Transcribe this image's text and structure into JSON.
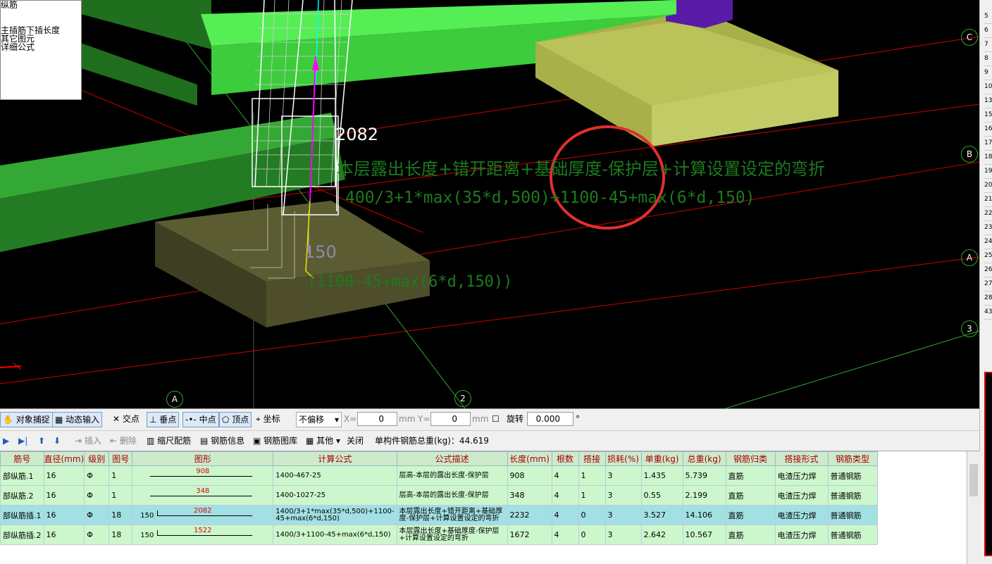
{
  "viewport": {
    "legend_lines": [
      "纵筋",
      "",
      "",
      "主插筋下插长度",
      "其它图元",
      "详细公式"
    ],
    "label_length_main": "2082",
    "label_length_sub": "150",
    "formula_desc": "本层露出长度+错开距离+基础厚度-保护层+计算设置设定的弯折",
    "formula_expr": "400/3+1*max(35*d,500)+1100-45+max(6*d,150)",
    "sub_expr": "(1100-45+max(6*d,150))",
    "axis_labels": {
      "c": "C",
      "b": "B",
      "a": "A",
      "n3": "3",
      "a_bottom": "A",
      "n2": "2"
    }
  },
  "right_strip": {
    "numbers": [
      "5",
      "6",
      "7",
      "8",
      "9",
      "10",
      "13",
      "15",
      "16",
      "17",
      "18",
      "19",
      "20",
      "21",
      "22",
      "23",
      "24",
      "25",
      "26",
      "27",
      "28",
      "43"
    ]
  },
  "toolbar1": {
    "snap": "对象捕捉",
    "dynamic_input": "动态输入",
    "intersection": "交点",
    "perpendicular": "垂点",
    "midpoint": "中点",
    "vertex": "顶点",
    "coordinate": "坐标",
    "offset_mode": "不偏移",
    "x_label": "X=",
    "x_value": "0",
    "x_unit": "mm",
    "y_label": "Y=",
    "y_value": "0",
    "y_unit": "mm",
    "rotate_label": "旋转",
    "rotate_value": "0.000",
    "degree": "°"
  },
  "toolbar2": {
    "insert": "插入",
    "delete": "删除",
    "scale_rebar": "缩尺配筋",
    "rebar_info": "钢筋信息",
    "rebar_library": "钢筋图库",
    "other": "其他",
    "close": "关闭",
    "total_weight": "单构件钢筋总重(kg)：44.619"
  },
  "table": {
    "headers": [
      "筋号",
      "直径(mm)",
      "级别",
      "图号",
      "图形",
      "计算公式",
      "公式描述",
      "长度(mm)",
      "根数",
      "搭接",
      "损耗(%)",
      "单重(kg)",
      "总重(kg)",
      "钢筋归类",
      "搭接形式",
      "钢筋类型"
    ],
    "rows": [
      {
        "style": "green",
        "name": "部纵筋.1",
        "dia": "16",
        "grade": "Φ",
        "fig": "1",
        "shape_pre": "",
        "shape_val": "908",
        "formula": "1400-467-25",
        "desc": "层高-本层的露出长度-保护层",
        "length": "908",
        "count": "4",
        "lap": "1",
        "loss": "3",
        "unit_w": "1.435",
        "total_w": "5.739",
        "cls": "直筋",
        "lap_type": "电渣压力焊",
        "type": "普通钢筋"
      },
      {
        "style": "green",
        "name": "部纵筋.2",
        "dia": "16",
        "grade": "Φ",
        "fig": "1",
        "shape_pre": "",
        "shape_val": "348",
        "formula": "1400-1027-25",
        "desc": "层高-本层的露出长度-保护层",
        "length": "348",
        "count": "4",
        "lap": "1",
        "loss": "3",
        "unit_w": "0.55",
        "total_w": "2.199",
        "cls": "直筋",
        "lap_type": "电渣压力焊",
        "type": "普通钢筋"
      },
      {
        "style": "cyan",
        "name": "部纵筋插.1",
        "dia": "16",
        "grade": "Φ",
        "fig": "18",
        "shape_pre": "150",
        "shape_val": "2082",
        "formula": "1400/3+1*max(35*d,500)+1100-45+max(6*d,150)",
        "desc": "本层露出长度+错开距离+基础厚度-保护层+计算设置设定的弯折",
        "length": "2232",
        "count": "4",
        "lap": "0",
        "loss": "3",
        "unit_w": "3.527",
        "total_w": "14.106",
        "cls": "直筋",
        "lap_type": "电渣压力焊",
        "type": "普通钢筋"
      },
      {
        "style": "green",
        "name": "部纵筋插.2",
        "dia": "16",
        "grade": "Φ",
        "fig": "18",
        "shape_pre": "150",
        "shape_val": "1522",
        "formula": "1400/3+1100-45+max(6*d,150)",
        "desc": "本层露出长度+基础厚度-保护层+计算设置设定的弯折",
        "length": "1672",
        "count": "4",
        "lap": "0",
        "loss": "3",
        "unit_w": "2.642",
        "total_w": "10.567",
        "cls": "直筋",
        "lap_type": "电渣压力焊",
        "type": "普通钢筋"
      }
    ]
  }
}
